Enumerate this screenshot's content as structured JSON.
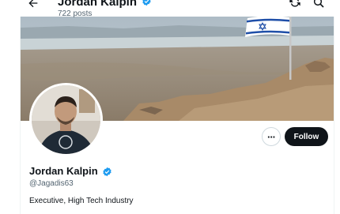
{
  "header": {
    "name": "Jordan Kalpin",
    "posts": "722 posts"
  },
  "actions": {
    "more_label": "···",
    "follow_label": "Follow"
  },
  "profile": {
    "display_name": "Jordan Kalpin",
    "handle": "@Jagadis63",
    "bio": "Executive, High Tech Industry"
  },
  "icons": {
    "back": "arrow-left-icon",
    "verified": "verified-badge-icon",
    "refresh": "refresh-icon",
    "search": "search-icon",
    "more": "more-options-icon"
  },
  "colors": {
    "verified": "#1d9bf0",
    "follow_button": "#0f1419",
    "secondary_text": "#536471"
  }
}
